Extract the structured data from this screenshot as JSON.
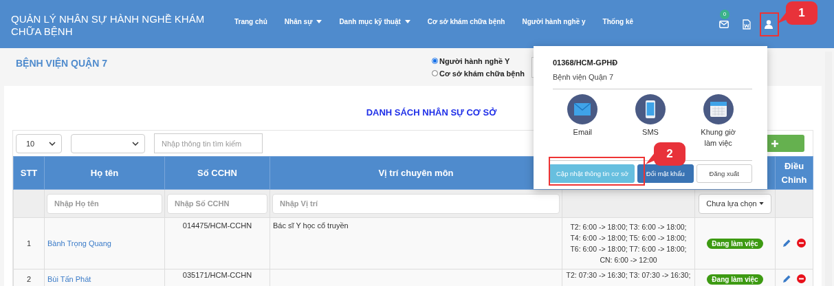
{
  "header": {
    "title": "QUẢN LÝ NHÂN SỰ HÀNH NGHỀ KHÁM CHỮA BỆNH",
    "mail_badge": "0",
    "nav": [
      {
        "label": "Trang chủ",
        "dropdown": false
      },
      {
        "label": "Nhân sự",
        "dropdown": true
      },
      {
        "label": "Danh mục kỹ thuật",
        "dropdown": true
      },
      {
        "label": "Cơ sở khám chữa bệnh",
        "dropdown": false
      },
      {
        "label": "Người hành nghề y",
        "dropdown": false
      },
      {
        "label": "Thống kê",
        "dropdown": false
      }
    ]
  },
  "subbar": {
    "facility": "BỆNH VIỆN QUẬN 7",
    "radios": [
      {
        "label": "Người hành nghề Y",
        "selected": true
      },
      {
        "label": "Cơ sở khám chữa bệnh",
        "selected": false
      }
    ]
  },
  "list": {
    "title": "DANH SÁCH NHÂN SỰ CƠ SỞ",
    "page_size": "10",
    "search_placeholder": "Nhập thông tin tìm kiếm",
    "columns": [
      "STT",
      "Họ tên",
      "Số CCHN",
      "Vị trí chuyên môn"
    ],
    "actions_column": "Điều Chỉnh",
    "filters": {
      "name_placeholder": "Nhập Họ tên",
      "cchn_placeholder": "Nhập Số CCHN",
      "position_placeholder": "Nhập Vị trí",
      "status": "Chưa lựa chọn"
    },
    "rows": [
      {
        "stt": "1",
        "name": "Bành Trọng Quang",
        "cchn": "014475/HCM-CCHN",
        "position": "Bác sĩ Y học cổ truyền",
        "schedule": "T2: 6:00 -> 18:00; T3: 6:00 -> 18:00; T4: 6:00 -> 18:00; T5: 6:00 -> 18:00; T6: 6:00 -> 18:00; T7: 6:00 -> 18:00; CN: 6:00 -> 12:00",
        "status": "Đang làm việc"
      },
      {
        "stt": "2",
        "name": "Bùi Tấn Phát",
        "cchn": "035171/HCM-CCHN",
        "schedule": "T2: 07:30 -> 16:30; T3: 07:30 -> 16:30;",
        "status": "Đang làm việc"
      }
    ]
  },
  "popup": {
    "code": "01368/HCM-GPHĐ",
    "name": "Bệnh viện Quận 7",
    "contacts": [
      {
        "kind": "email",
        "label": "Email"
      },
      {
        "kind": "sms",
        "label": "SMS"
      },
      {
        "kind": "calendar",
        "label": "Khung giờ làm việc"
      }
    ],
    "buttons": [
      {
        "kind": "info",
        "label": "Cập nhật thông tin cơ sở"
      },
      {
        "kind": "primary",
        "label": "Đổi mật khẩu"
      },
      {
        "kind": "default",
        "label": "Đăng xuất"
      }
    ]
  },
  "annotations": [
    {
      "label": "1"
    },
    {
      "label": "2"
    }
  ]
}
